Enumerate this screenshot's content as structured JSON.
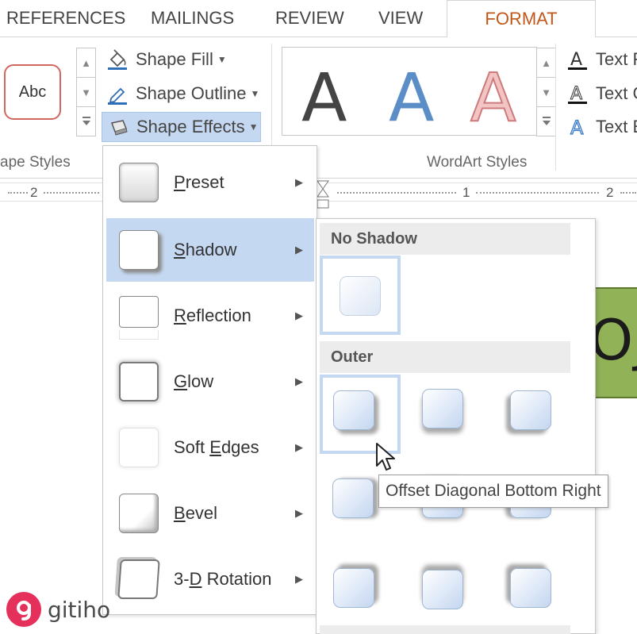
{
  "tabs": [
    {
      "label": "REFERENCES"
    },
    {
      "label": "MAILINGS"
    },
    {
      "label": "REVIEW"
    },
    {
      "label": "VIEW"
    },
    {
      "label": "FORMAT",
      "active": true
    }
  ],
  "ribbon": {
    "shape_styles": {
      "group_label": "ape Styles",
      "preview_text": "Abc",
      "commands": [
        {
          "label": "Shape Fill",
          "icon": "paint-bucket-icon"
        },
        {
          "label": "Shape Outline",
          "icon": "pen-outline-icon"
        },
        {
          "label": "Shape Effects",
          "icon": "shape-effects-icon",
          "active": true
        }
      ]
    },
    "wordart_styles": {
      "group_label": "WordArt Styles",
      "letters": [
        {
          "char": "A",
          "color": "#111111"
        },
        {
          "char": "A",
          "color": "#5b8ec6"
        },
        {
          "char": "A",
          "color": "#e8a6a6"
        }
      ],
      "commands": [
        {
          "label": "Text F",
          "icon": "text-fill-icon"
        },
        {
          "label": "Text C",
          "icon": "text-outline-icon"
        },
        {
          "label": "Text E",
          "icon": "text-effects-icon"
        }
      ]
    }
  },
  "ruler": {
    "left_number": "2",
    "numbers": [
      "1",
      "2"
    ]
  },
  "document": {
    "shape_text": "Oj",
    "shape_fill": "#92b258"
  },
  "effects_menu": {
    "items": [
      {
        "label": "Preset",
        "mnemonic": "P",
        "rest": "reset"
      },
      {
        "label": "Shadow",
        "mnemonic": "S",
        "rest": "hadow",
        "active": true
      },
      {
        "label": "Reflection",
        "mnemonic": "R",
        "rest": "eflection"
      },
      {
        "label": "Glow",
        "mnemonic": "G",
        "rest": "low"
      },
      {
        "label": "Soft Edges",
        "pre": "Soft ",
        "mnemonic": "E",
        "rest": "dges"
      },
      {
        "label": "Bevel",
        "mnemonic": "B",
        "rest": "evel"
      },
      {
        "label": "3-D Rotation",
        "pre": "3-",
        "mnemonic": "D",
        "rest": " Rotation"
      }
    ]
  },
  "shadow_menu": {
    "no_shadow_heading": "No Shadow",
    "outer_heading": "Outer",
    "outer_presets": [
      "Offset Diagonal Bottom Right",
      "Offset Bottom",
      "Offset Diagonal Bottom Left",
      "Offset Right",
      "Offset Center",
      "Offset Left",
      "Offset Diagonal Top Right",
      "Offset Top",
      "Offset Diagonal Top Left"
    ],
    "hovered": "Offset Diagonal Bottom Right"
  },
  "tooltip": {
    "text": "Offset Diagonal Bottom Right"
  },
  "logo": {
    "letter": "g",
    "wordmark": "gitiho",
    "color": "#e4305b"
  },
  "colors": {
    "accent_tab": "#c2571a",
    "highlight": "#c5d8f1"
  }
}
